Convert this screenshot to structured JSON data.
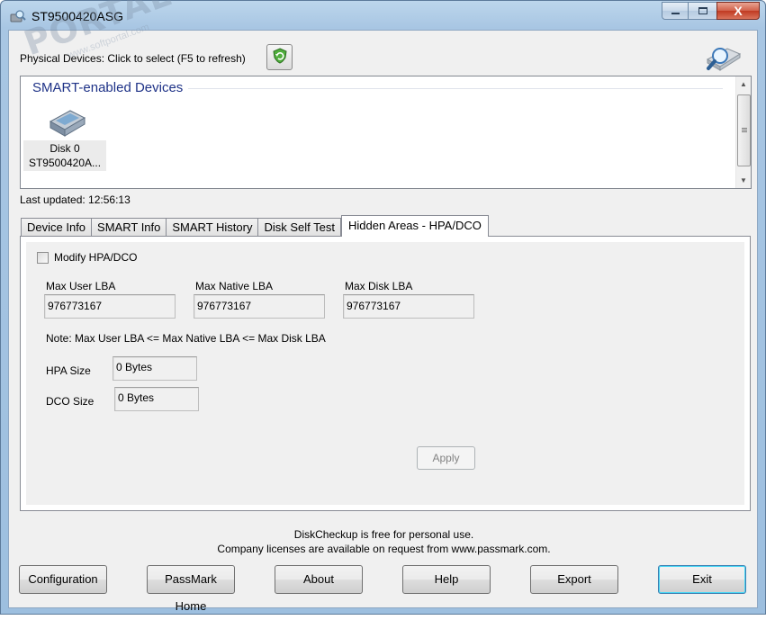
{
  "window": {
    "title": "ST9500420ASG",
    "minimize_label": "—",
    "maximize_label": "□",
    "close_label": "X"
  },
  "devices": {
    "label": "Physical Devices: Click to select (F5 to refresh)",
    "group_header": "SMART-enabled Devices",
    "items": [
      {
        "name": "Disk 0",
        "model": "ST9500420A..."
      }
    ],
    "last_updated": "Last updated: 12:56:13"
  },
  "tabs": [
    {
      "label": "Device Info",
      "active": false
    },
    {
      "label": "SMART Info",
      "active": false
    },
    {
      "label": "SMART History",
      "active": false
    },
    {
      "label": "Disk Self Test",
      "active": false
    },
    {
      "label": "Hidden Areas - HPA/DCO",
      "active": true
    }
  ],
  "hpa": {
    "modify_label": "Modify HPA/DCO",
    "modify_checked": false,
    "max_user_lba_label": "Max User LBA",
    "max_user_lba": "976773167",
    "max_native_lba_label": "Max Native LBA",
    "max_native_lba": "976773167",
    "max_disk_lba_label": "Max Disk LBA",
    "max_disk_lba": "976773167",
    "note": "Note: Max User LBA <= Max Native LBA <= Max Disk LBA",
    "hpa_size_label": "HPA Size",
    "hpa_size": "0 Bytes",
    "dco_size_label": "DCO Size",
    "dco_size": "0 Bytes",
    "apply_label": "Apply"
  },
  "footer": {
    "line1": "DiskCheckup is free for personal use.",
    "line2": "Company licenses are available on request from www.passmark.com."
  },
  "buttons": {
    "configuration": "Configuration",
    "passmark_home": "PassMark Home",
    "about": "About",
    "help": "Help",
    "export": "Export",
    "exit": "Exit"
  },
  "watermark": {
    "text": "PORTAL",
    "sub": "www.softportal.com"
  },
  "icons": {
    "app": "disk-magnifier-icon",
    "refresh": "refresh-shield-icon",
    "logo": "magnifier-logo-icon",
    "disk": "hard-disk-icon"
  },
  "colors": {
    "title_bar": "#a8c6e3",
    "group_header": "#1e3287",
    "close_button": "#c03a22",
    "default_button_border": "#3c7fb1"
  }
}
